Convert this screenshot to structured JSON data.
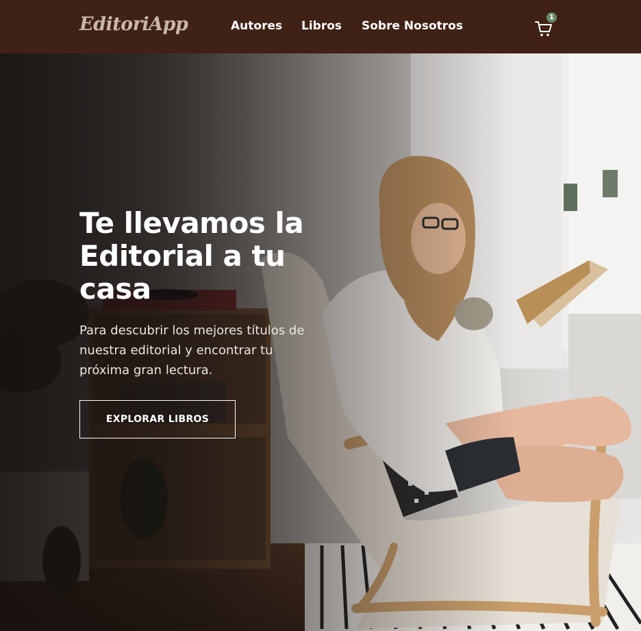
{
  "navbar": {
    "logo": "EditoriApp",
    "links": [
      {
        "label": "Autores"
      },
      {
        "label": "Libros"
      },
      {
        "label": "Sobre Nosotros"
      }
    ],
    "cart": {
      "icon": "cart-icon",
      "count": "1",
      "badge_color": "#6b8a6b"
    }
  },
  "hero": {
    "title": "Te llevamos la Editorial a tu casa",
    "subtitle": "Para descubrir los mejores títulos de nuestra editorial y encontrar tu próxima gran lectura.",
    "cta_label": "EXPLORAR LIBROS"
  },
  "colors": {
    "navbar_bg": "#3f2116",
    "logo": "#c9b8a7",
    "text": "#ffffff"
  }
}
